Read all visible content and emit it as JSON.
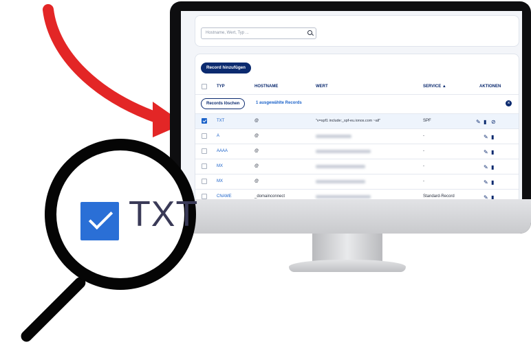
{
  "search": {
    "placeholder": "Hostname, Wert, Typ ..."
  },
  "toolbar": {
    "add_label": "Record hinzufügen"
  },
  "table": {
    "headers": {
      "typ": "TYP",
      "hostname": "HOSTNAME",
      "wert": "WERT",
      "service": "SERVICE ▲",
      "aktionen": "AKTIONEN"
    },
    "bulk": {
      "delete_label": "Records löschen",
      "selected_text": "1 ausgewählte Records"
    },
    "rows": [
      {
        "typ": "TXT",
        "hostname": "@",
        "wert": "\"v=spf1 include:_spf-eu.ionos.com ~all\"",
        "service": "SPF",
        "checked": true
      },
      {
        "typ": "A",
        "hostname": "@",
        "wert": "",
        "service": "-",
        "checked": false
      },
      {
        "typ": "AAAA",
        "hostname": "@",
        "wert": "",
        "service": "-",
        "checked": false
      },
      {
        "typ": "MX",
        "hostname": "@",
        "wert": "",
        "service": "-",
        "checked": false
      },
      {
        "typ": "MX",
        "hostname": "@",
        "wert": "",
        "service": "-",
        "checked": false
      },
      {
        "typ": "CNAME",
        "hostname": "_domainconnect",
        "wert": "",
        "service": "Standard-Record",
        "checked": false
      }
    ]
  },
  "magnifier": {
    "label": "TXT",
    "checked": true
  },
  "colors": {
    "accent": "#0b2a6f",
    "link": "#1b62c9",
    "arrow": "#e32626"
  }
}
